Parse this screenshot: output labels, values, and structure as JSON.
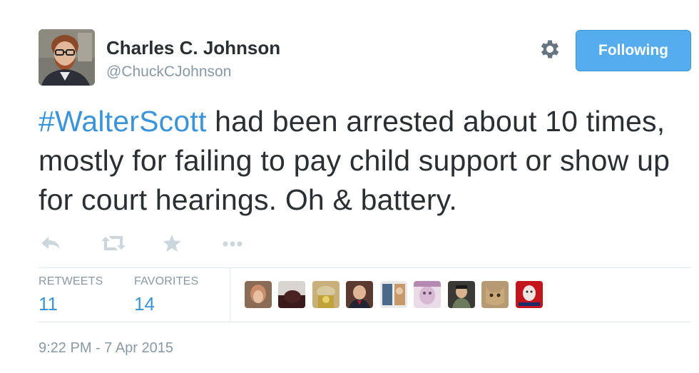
{
  "user": {
    "name": "Charles C. Johnson",
    "handle": "@ChuckCJohnson"
  },
  "follow_button": {
    "label": "Following"
  },
  "tweet": {
    "hashtag": "#WalterScott",
    "text": " had been arrested about 10 times, mostly for failing to pay child support or show up for court hearings. Oh & battery."
  },
  "actions": {
    "icons": [
      "reply-icon",
      "retweet-icon",
      "favorite-star-icon",
      "more-icon"
    ]
  },
  "stats": {
    "retweets_label": "RETWEETS",
    "retweets_count": "11",
    "favorites_label": "FAVORITES",
    "favorites_count": "14"
  },
  "timestamp": "9:22 PM - 7 Apr 2015",
  "colors": {
    "link_blue": "#3b94d9",
    "button_blue": "#55acee",
    "muted_gray": "#8899a6",
    "text": "#292f33",
    "border": "#e1e8ed"
  }
}
